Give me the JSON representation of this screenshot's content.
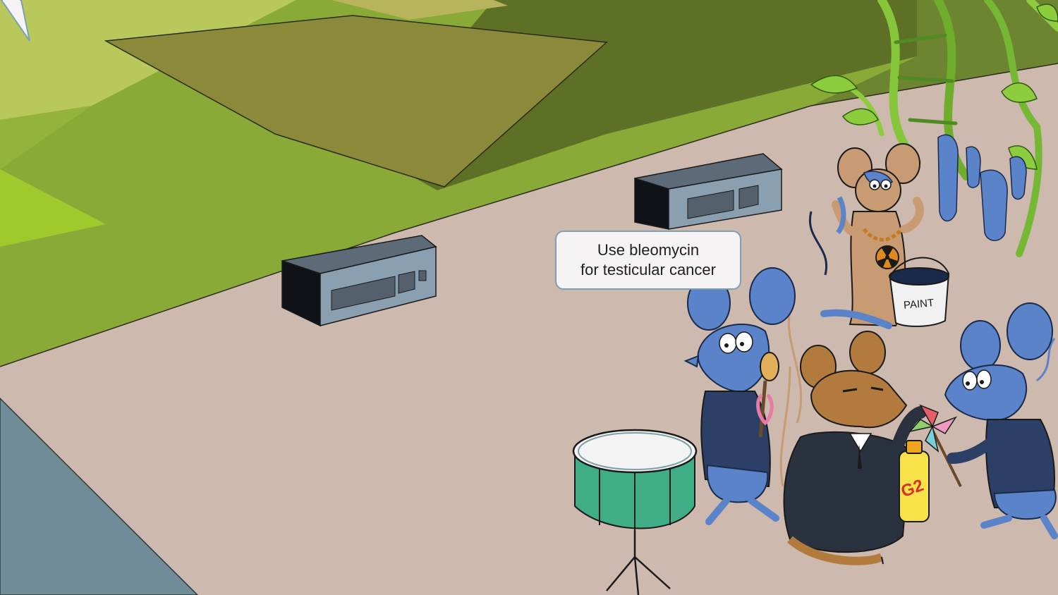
{
  "speech_bubble": {
    "line1": "Use bleomycin",
    "line2": "for testicular cancer"
  },
  "paint_can": {
    "label": "PAINT"
  },
  "drink_bottle": {
    "label": "G2"
  },
  "colors": {
    "floor": "#cdb9ad",
    "grass_light": "#8fb33a",
    "grass_olive": "#8c8a3a",
    "grass_dark": "#5f6f2c",
    "water": "#6f8c98",
    "mouse_blue": "#5a83c9",
    "mouse_brown": "#b37a3e",
    "drum_green": "#3fae86"
  }
}
